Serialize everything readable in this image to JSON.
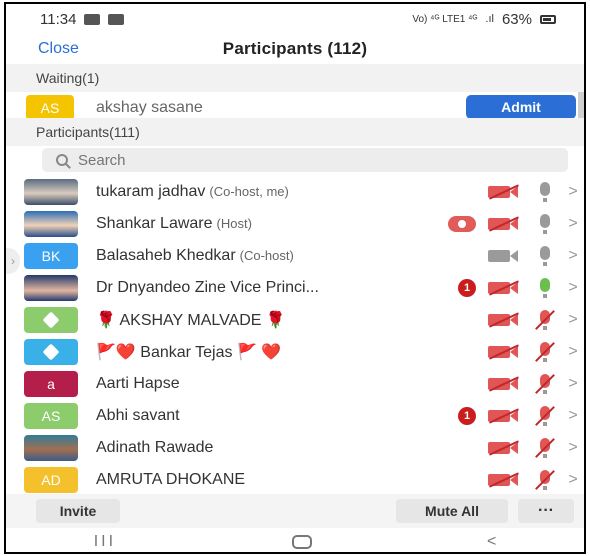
{
  "status_bar": {
    "time": "11:34",
    "network": "Vo) ⁴ᴳ LTE1 ⁴ᴳ",
    "battery": "63%"
  },
  "header": {
    "close_label": "Close",
    "title": "Participants (112)"
  },
  "waiting": {
    "section_label": "Waiting(1)",
    "person": {
      "initials": "AS",
      "name": "akshay sasane",
      "color": "#f5c400"
    },
    "admit_label": "Admit"
  },
  "participants_section_label": "Participants(111)",
  "search": {
    "placeholder": "Search"
  },
  "participants": [
    {
      "name": "tukaram jadhav",
      "role": "(Co-host, me)",
      "avatar": "photo",
      "camera": "off",
      "mic": "on"
    },
    {
      "name": "Shankar Laware",
      "role": "(Host)",
      "avatar": "photo2",
      "share": true,
      "camera": "off",
      "mic": "on"
    },
    {
      "name": "Balasaheb Khedkar",
      "role": "(Co-host)",
      "initials": "BK",
      "color": "#3aa0f0",
      "camera": "on",
      "mic": "on"
    },
    {
      "name": "Dr Dnyandeo Zine Vice Princi...",
      "role": "",
      "avatar": "photo3",
      "badge": "1",
      "camera": "off",
      "mic": "green"
    },
    {
      "name": "🌹 AKSHAY MALVADE 🌹",
      "role": "",
      "icon": "diamond",
      "color": "#8ccc6c",
      "camera": "off",
      "mic": "muted"
    },
    {
      "name": "🚩❤️ Bankar Tejas 🚩 ❤️",
      "role": "",
      "icon": "diamond",
      "color": "#3ab0e8",
      "camera": "off",
      "mic": "muted"
    },
    {
      "name": "Aarti Hapse",
      "role": "",
      "initials": "a",
      "color": "#b41e4a",
      "camera": "off",
      "mic": "muted"
    },
    {
      "name": "Abhi savant",
      "role": "",
      "initials": "AS",
      "color": "#8ccc6c",
      "badge": "1",
      "camera": "off",
      "mic": "muted"
    },
    {
      "name": "Adinath Rawade",
      "role": "",
      "avatar": "photo4",
      "camera": "off",
      "mic": "muted"
    },
    {
      "name": "AMRUTA DHOKANE",
      "role": "",
      "initials": "AD",
      "color": "#f4c12d",
      "camera": "off",
      "mic": "muted"
    }
  ],
  "bottom": {
    "invite_label": "Invite",
    "mute_all_label": "Mute All",
    "more_label": "···"
  },
  "nav": {
    "recents": "III",
    "back": "<"
  }
}
